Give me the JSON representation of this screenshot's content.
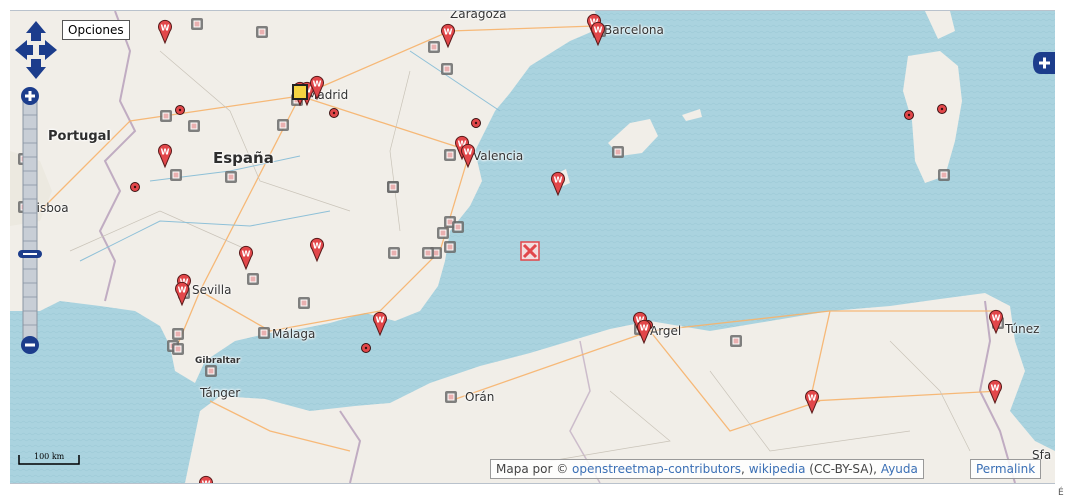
{
  "controls": {
    "options_label": "Opciones",
    "zoom_in": "+",
    "zoom_out": "−",
    "layer_switcher": "+"
  },
  "labels": {
    "countries": [
      {
        "id": "espana",
        "text": "España"
      },
      {
        "id": "portugal",
        "text": "Portugal"
      }
    ],
    "cities": [
      {
        "id": "madrid",
        "text": "Madrid"
      },
      {
        "id": "barcelona",
        "text": "Barcelona"
      },
      {
        "id": "valencia",
        "text": "Valencia"
      },
      {
        "id": "sevilla",
        "text": "Sevilla"
      },
      {
        "id": "malaga",
        "text": "Málaga"
      },
      {
        "id": "tanger",
        "text": "Tánger"
      },
      {
        "id": "oran",
        "text": "Orán"
      },
      {
        "id": "argel",
        "text": "Argel"
      },
      {
        "id": "tunez",
        "text": "Túnez"
      },
      {
        "id": "lisboa",
        "text": "Lisboa"
      },
      {
        "id": "zaragoza",
        "text": "Zaragoza"
      },
      {
        "id": "gibraltar",
        "text": "Gibraltar"
      },
      {
        "id": "sfa",
        "text": "Sfa"
      }
    ]
  },
  "scale": {
    "label": "100 km"
  },
  "attribution": {
    "prefix": "Mapa por ©",
    "osm": "openstreetmap-contributors",
    "sep": ",",
    "wikipedia": "wikipedia",
    "license": "(CC-BY-SA),",
    "help": "Ayuda",
    "permalink": "Permalink"
  },
  "corner_text": "É",
  "colors": {
    "sea": "#aad3df",
    "land": "#f1eee8",
    "marker_red": "#e2474a",
    "control_blue": "#1c3d8c"
  }
}
